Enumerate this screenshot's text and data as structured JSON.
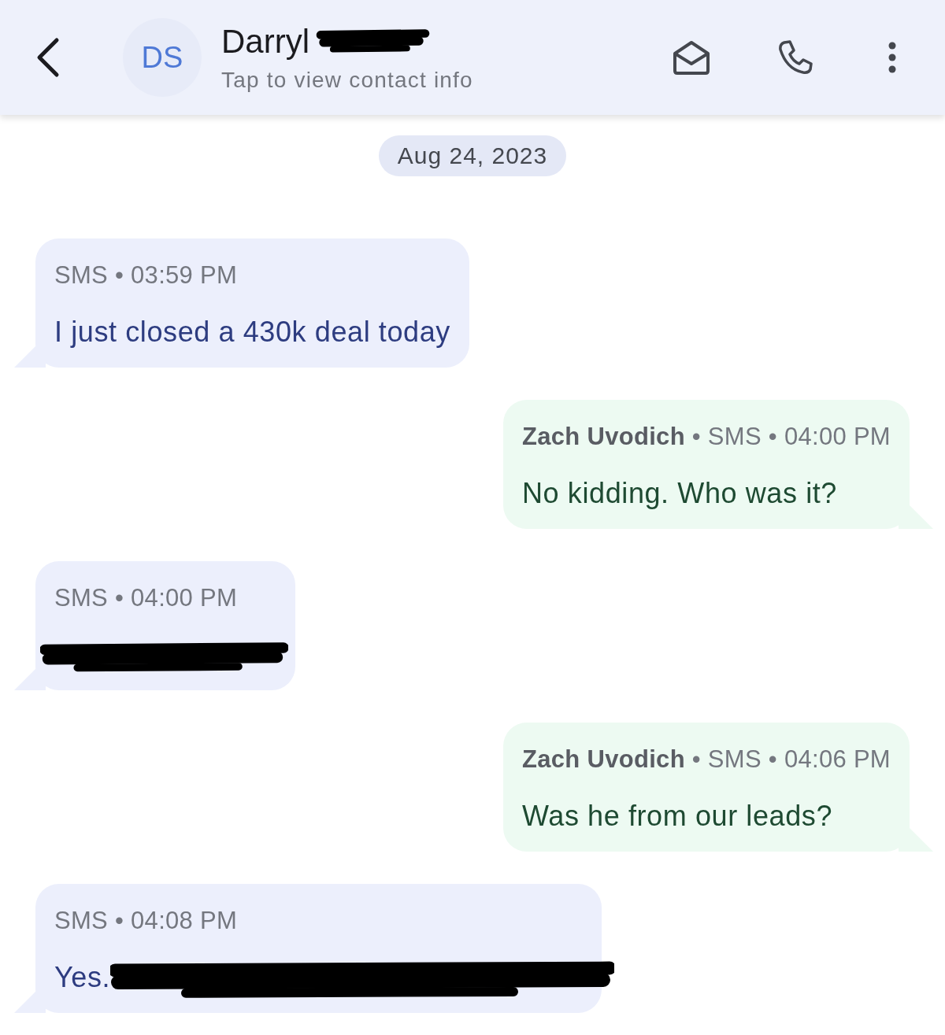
{
  "header": {
    "avatar_initials": "DS",
    "contact_name": "Darryl",
    "contact_name_redacted": true,
    "subtitle": "Tap to view contact info"
  },
  "date_chip": "Aug 24, 2023",
  "messages": [
    {
      "kind": "incoming",
      "meta": "SMS • 03:59 PM",
      "body": "I just closed a 430k deal today",
      "redacted": false
    },
    {
      "kind": "outgoing",
      "meta": "**Zach Uvodich** • SMS • 04:00 PM",
      "body": "No kidding. Who was it?",
      "redacted": false
    },
    {
      "kind": "incoming",
      "meta": "SMS • 04:00 PM",
      "redacted": true
    },
    {
      "kind": "outgoing",
      "meta": "**Zach Uvodich** • SMS • 04:06 PM",
      "body": "Was he from our leads?",
      "redacted": false
    },
    {
      "kind": "incoming",
      "meta": "SMS • 04:08 PM",
      "body": "Yes.",
      "redacted": true
    }
  ]
}
